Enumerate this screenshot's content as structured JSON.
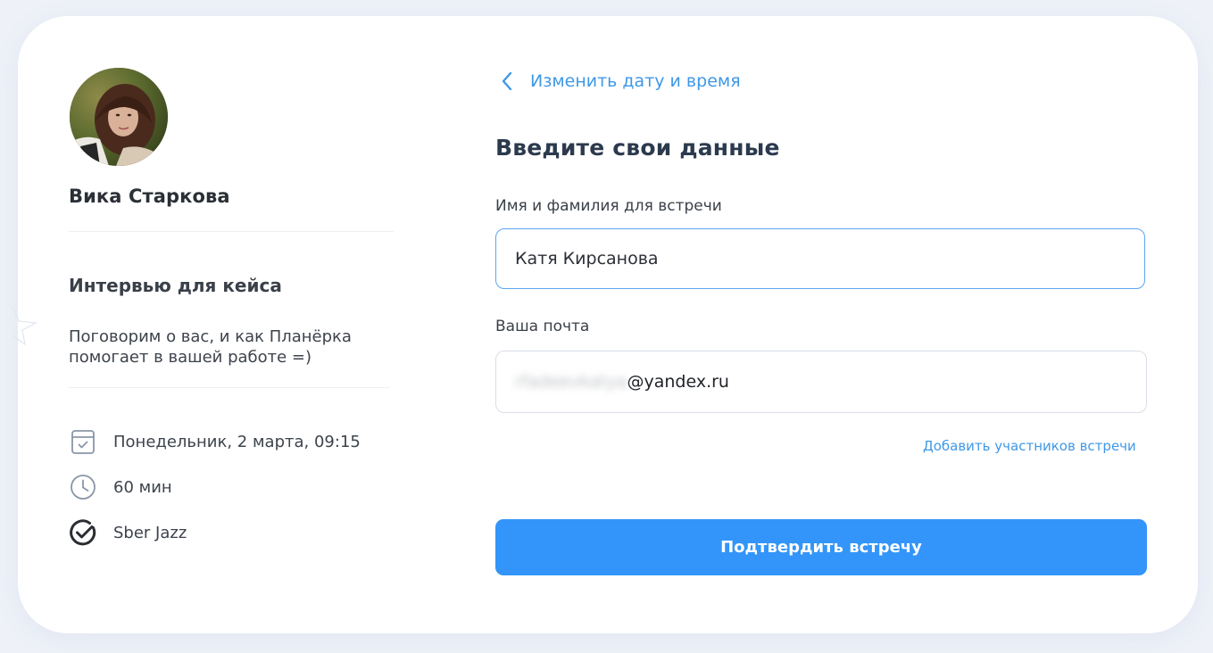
{
  "host": {
    "name": "Вика Старкова"
  },
  "event": {
    "title": "Интервью для кейса",
    "description": "Поговорим о вас, и как Планёрка помогает в вашей работе =)",
    "details": [
      {
        "icon": "calendar-icon",
        "text": "Понедельник, 2 марта, 09:15"
      },
      {
        "icon": "clock-icon",
        "text": "60 мин"
      },
      {
        "icon": "sber-jazz-icon",
        "text": "Sber Jazz"
      }
    ]
  },
  "form": {
    "back_label": "Изменить дату и время",
    "title": "Введите свои данные",
    "name_label": "Имя и фамилия для встречи",
    "name_value": "Катя Кирсанова",
    "email_label": "Ваша почта",
    "email_local_hidden": "rfadeevkatya",
    "email_domain": "@yandex.ru",
    "add_participants_label": "Добавить участников встречи",
    "confirm_label": "Подтвердить встречу"
  },
  "colors": {
    "accent": "#3395f9",
    "link": "#3f98e6",
    "background": "#eef1f8"
  }
}
